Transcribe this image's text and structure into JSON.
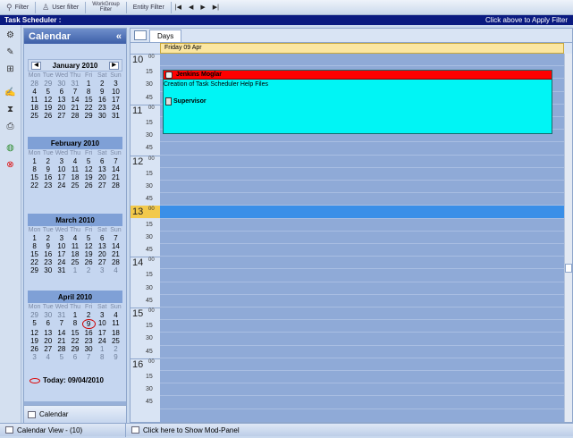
{
  "toolbar": {
    "filter": "Filter",
    "user_filter": "User filter",
    "workgroup_filter_1": "WorkGroup",
    "workgroup_filter_2": "Filter",
    "entity_filter": "Entity Filter",
    "nav": [
      "|◀",
      "◀",
      "▶",
      "▶|"
    ]
  },
  "titlebar": {
    "title": "Task Scheduler :",
    "hint": "Click above to Apply Filter"
  },
  "iconstrip": [
    "task-icon",
    "edit-icon",
    "tree-icon",
    "user-edit-icon",
    "hourglass-icon",
    "print-icon",
    "globe-icon",
    "delete-icon"
  ],
  "calendar": {
    "title": "Calendar",
    "collapse": "«",
    "dow": [
      "Mon",
      "Tue",
      "Wed",
      "Thu",
      "Fri",
      "Sat",
      "Sun"
    ],
    "months": [
      {
        "name": "January 2010",
        "weeks": [
          [
            "28",
            "29",
            "30",
            "31",
            "1",
            "2",
            "3"
          ],
          [
            "4",
            "5",
            "6",
            "7",
            "8",
            "9",
            "10"
          ],
          [
            "11",
            "12",
            "13",
            "14",
            "15",
            "16",
            "17"
          ],
          [
            "18",
            "19",
            "20",
            "21",
            "22",
            "23",
            "24"
          ],
          [
            "25",
            "26",
            "27",
            "28",
            "29",
            "30",
            "31"
          ]
        ],
        "other": [
          [
            0,
            0
          ],
          [
            0,
            1
          ],
          [
            0,
            2
          ],
          [
            0,
            3
          ]
        ]
      },
      {
        "name": "February 2010",
        "weeks": [
          [
            "1",
            "2",
            "3",
            "4",
            "5",
            "6",
            "7"
          ],
          [
            "8",
            "9",
            "10",
            "11",
            "12",
            "13",
            "14"
          ],
          [
            "15",
            "16",
            "17",
            "18",
            "19",
            "20",
            "21"
          ],
          [
            "22",
            "23",
            "24",
            "25",
            "26",
            "27",
            "28"
          ]
        ],
        "other": []
      },
      {
        "name": "March 2010",
        "weeks": [
          [
            "1",
            "2",
            "3",
            "4",
            "5",
            "6",
            "7"
          ],
          [
            "8",
            "9",
            "10",
            "11",
            "12",
            "13",
            "14"
          ],
          [
            "15",
            "16",
            "17",
            "18",
            "19",
            "20",
            "21"
          ],
          [
            "22",
            "23",
            "24",
            "25",
            "26",
            "27",
            "28"
          ],
          [
            "29",
            "30",
            "31",
            "1",
            "2",
            "3",
            "4"
          ]
        ],
        "other": [
          [
            4,
            3
          ],
          [
            4,
            4
          ],
          [
            4,
            5
          ],
          [
            4,
            6
          ]
        ]
      },
      {
        "name": "April 2010",
        "weeks": [
          [
            "29",
            "30",
            "31",
            "1",
            "2",
            "3",
            "4"
          ],
          [
            "5",
            "6",
            "7",
            "8",
            "9",
            "10",
            "11"
          ],
          [
            "12",
            "13",
            "14",
            "15",
            "16",
            "17",
            "18"
          ],
          [
            "19",
            "20",
            "21",
            "22",
            "23",
            "24",
            "25"
          ],
          [
            "26",
            "27",
            "28",
            "29",
            "30",
            "1",
            "2"
          ],
          [
            "3",
            "4",
            "5",
            "6",
            "7",
            "8",
            "9"
          ]
        ],
        "other": [
          [
            0,
            0
          ],
          [
            0,
            1
          ],
          [
            0,
            2
          ],
          [
            4,
            5
          ],
          [
            4,
            6
          ],
          [
            5,
            0
          ],
          [
            5,
            1
          ],
          [
            5,
            2
          ],
          [
            5,
            3
          ],
          [
            5,
            4
          ],
          [
            5,
            5
          ],
          [
            5,
            6
          ]
        ],
        "selected": [
          1,
          4
        ]
      }
    ],
    "today": "Today: 09/04/2010",
    "footer_label": "Calendar",
    "footer_arrow": "▼"
  },
  "scheduler": {
    "tab": "Days",
    "day_header": "Friday  09 Apr",
    "times": [
      {
        "hour": "10",
        "mins": [
          "00",
          "15",
          "30",
          "45"
        ]
      },
      {
        "hour": "11",
        "mins": [
          "00",
          "15",
          "30",
          "45"
        ]
      },
      {
        "hour": "12",
        "mins": [
          "00",
          "15",
          "30",
          "45"
        ]
      },
      {
        "hour": "13",
        "mins": [
          "00",
          "15",
          "30",
          "45"
        ]
      },
      {
        "hour": "14",
        "mins": [
          "00",
          "15",
          "30",
          "45"
        ]
      },
      {
        "hour": "15",
        "mins": [
          "00",
          "15",
          "30",
          "45"
        ]
      },
      {
        "hour": "16",
        "mins": [
          "00",
          "15",
          "30",
          "45"
        ]
      }
    ],
    "current_hour": "13",
    "appointment": {
      "name": "Jenkins Moglar",
      "description": "Creation of Task Scheduler Help Files",
      "role": "Supervisor",
      "bar_color": "#ff0000",
      "fill_color": "#00f5f5"
    }
  },
  "statusbar": {
    "left": "Calendar View - (10)",
    "right": "Click here to Show Mod-Panel"
  }
}
